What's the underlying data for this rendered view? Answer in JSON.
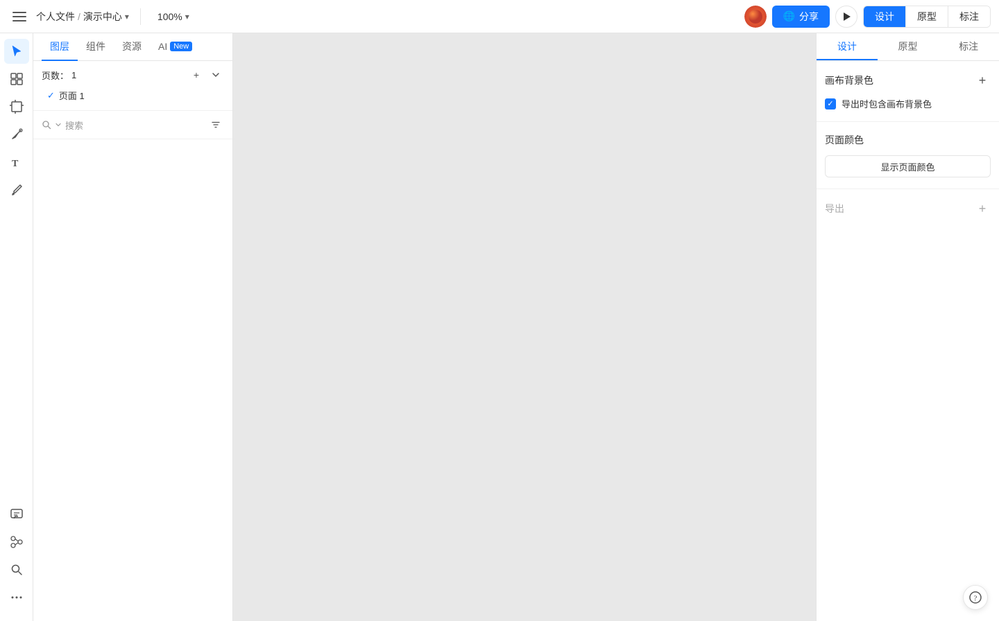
{
  "topbar": {
    "menu_label": "☰",
    "breadcrumb_home": "个人文件",
    "breadcrumb_sep": "/",
    "breadcrumb_current": "演示中心",
    "zoom_level": "100%",
    "share_label": "分享",
    "share_icon": "🌐",
    "design_tab": "设计",
    "prototype_tab": "原型",
    "mark_tab": "标注"
  },
  "left_panel": {
    "tab_layers": "图层",
    "tab_components": "组件",
    "tab_assets": "资源",
    "tab_ai": "AI",
    "tab_new_badge": "New",
    "pages_label": "页数：",
    "pages_count": "1",
    "page_item": "页面 1",
    "search_placeholder": "搜索"
  },
  "right_panel": {
    "tab_design": "设计",
    "tab_prototype": "原型",
    "tab_mark": "标注",
    "canvas_bg_title": "画布背景色",
    "export_canvas_bg_label": "导出时包含画布背景色",
    "page_color_title": "页面颜色",
    "show_page_color_btn": "显示页面颜色",
    "export_title": "导出"
  },
  "toolbar": {
    "select_tool": "▶",
    "grid_tool": "#",
    "frame_tool": "⬜",
    "pen_tool": "✒",
    "text_tool": "T",
    "brush_tool": "✏",
    "comment_tool": "💬",
    "connect_tool": "⬡",
    "search_tool": "🔍",
    "more_tool": "⋯"
  },
  "colors": {
    "accent": "#1677ff",
    "border": "#e5e5e5",
    "bg_canvas": "#e8e8e8",
    "bg_panel": "#ffffff"
  }
}
